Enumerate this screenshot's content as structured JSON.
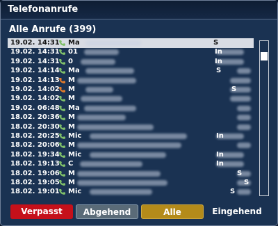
{
  "window": {
    "title": "Telefonanrufe"
  },
  "list": {
    "header": "Alle Anrufe (399)",
    "rows": [
      {
        "time": "19.02. 14:31",
        "name": "Ma",
        "type": "S",
        "icon": "incoming-call-icon"
      },
      {
        "time": "19.02. 14:31",
        "name": "01",
        "type": "In",
        "icon": "incoming-call-icon"
      },
      {
        "time": "19.02. 14:31",
        "name": "0",
        "type": "In",
        "icon": "incoming-call-icon"
      },
      {
        "time": "19.02. 14:14",
        "name": "Ma",
        "type": "S",
        "icon": "incoming-call-icon"
      },
      {
        "time": "19.02. 14:13",
        "name": "M",
        "type": "",
        "icon": "missed-call-icon"
      },
      {
        "time": "19.02. 14:02",
        "name": "M",
        "type": "S",
        "icon": "missed-call-icon"
      },
      {
        "time": "19.02. 14:02",
        "name": "M",
        "type": "",
        "icon": "incoming-call-icon"
      },
      {
        "time": "19.02. 06:48",
        "name": "Ma",
        "type": "",
        "icon": "incoming-call-icon"
      },
      {
        "time": "18.02. 20:36",
        "name": "M",
        "type": "",
        "icon": "incoming-call-icon"
      },
      {
        "time": "18.02. 20:30",
        "name": "M",
        "type": "",
        "icon": "incoming-call-icon"
      },
      {
        "time": "18.02. 20:25",
        "name": "Mic",
        "type": "In",
        "icon": "incoming-call-icon"
      },
      {
        "time": "18.02. 20:06",
        "name": "M",
        "type": "",
        "icon": "incoming-call-icon"
      },
      {
        "time": "18.02. 19:34",
        "name": "Mic",
        "type": "In",
        "icon": "incoming-call-icon"
      },
      {
        "time": "18.02. 19:13",
        "name": "C",
        "type": "In",
        "icon": "incoming-call-icon"
      },
      {
        "time": "18.02. 19:06",
        "name": "M",
        "type": "S",
        "icon": "incoming-call-icon"
      },
      {
        "time": "18.02. 19:05",
        "name": "M",
        "type": "S",
        "icon": "incoming-call-icon"
      },
      {
        "time": "18.02. 19:01",
        "name": "Mic",
        "type": "S",
        "icon": "incoming-call-icon"
      }
    ]
  },
  "buttons": {
    "missed": "Verpasst",
    "outgoing": "Abgehend",
    "all": "Alle",
    "incoming": "Eingehend"
  },
  "colors": {
    "missed": "#c5101a",
    "outgoing": "#5a6b78",
    "all": "#b48b1a",
    "background": "#1a3252"
  }
}
